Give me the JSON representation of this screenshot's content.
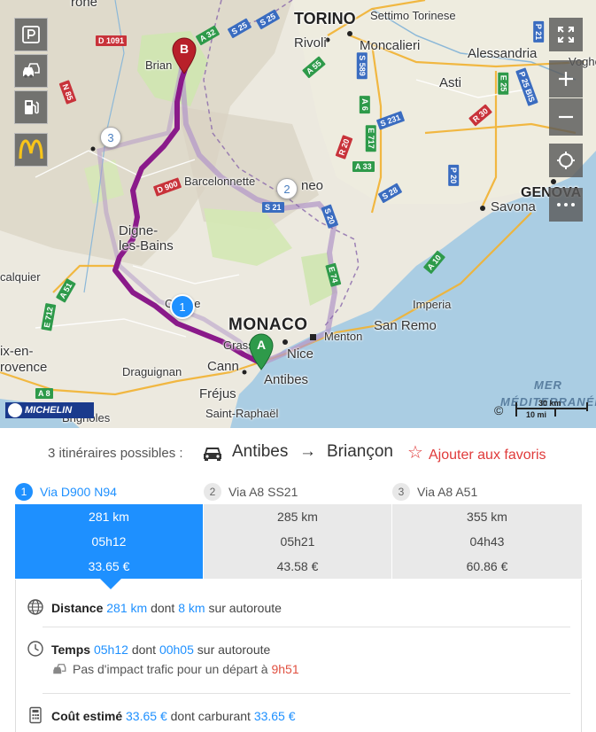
{
  "map": {
    "places": {
      "torino": "TORINO",
      "settimo": "Settimo Torinese",
      "rivoli": "Rivoli",
      "moncalieri": "Moncalieri",
      "alessandria": "Alessandria",
      "voghera": "Voghe",
      "asti": "Asti",
      "briancon": "Brian",
      "barcelonnette": "Barcelonnette",
      "cuneo": "neo",
      "genova": "GENOVA",
      "savona": "Savona",
      "digne1": "Digne-",
      "digne2": "les-Bains",
      "forcalquier": "calquier",
      "castellane": "C    llane",
      "monaco": "MONACO",
      "menton": "Menton",
      "imperia": "Imperia",
      "sanremo": "San Remo",
      "nice": "Nice",
      "grasse": "Grass",
      "cannes": "Cann",
      "antibes": "Antibes",
      "draguignan": "Draguignan",
      "frejus": "Fréjus",
      "saintraphael": "Saint-Raphaël",
      "brignoles": "Brignoles",
      "aix1": "ix-en-",
      "aix2": "rovence",
      "sea1": "MER",
      "sea2": "MÉDITERRANÉE",
      "top_brone": "rône"
    },
    "shields": {
      "d1091": "D 1091",
      "a32": "A 32",
      "s25": "S 25",
      "a55": "A 55",
      "s589": "S 589",
      "e717": "E 717",
      "a6": "A 6",
      "s231": "S 231",
      "r20": "R 20",
      "a33": "A 33",
      "e25": "E 25",
      "p25bis": "P 25 BIS",
      "r30": "R 30",
      "n85": "N 85",
      "d900": "D 900",
      "s21": "S 21",
      "s20": "S 20",
      "e74": "E 74",
      "s28": "S 28",
      "a10": "A 10",
      "p20": "P 20",
      "a51": "A 51",
      "a8": "A 8",
      "e712": "E 712",
      "p21": "P 21"
    },
    "route_markers": [
      "1",
      "2",
      "3"
    ],
    "pins": {
      "start": "A",
      "end": "B"
    },
    "logo": "MICHELIN",
    "copyright": "©",
    "scale": {
      "km": "30 km",
      "mi": "10 mi"
    },
    "controls_left": [
      "parking-icon",
      "traffic-icon",
      "fuel-icon",
      "mcdonalds-icon"
    ],
    "controls_right": [
      "fullscreen-icon",
      "zoom-in-icon",
      "zoom-out-icon",
      "locate-icon",
      "more-icon"
    ]
  },
  "header": {
    "possible": "3 itinéraires possibles :",
    "from": "Antibes",
    "arrow": "→",
    "to": "Briançon",
    "favorite": "Ajouter aux favoris"
  },
  "tabs": [
    {
      "num": "1",
      "label": "Via D900 N94"
    },
    {
      "num": "2",
      "label": "Via A8 SS21"
    },
    {
      "num": "3",
      "label": "Via A8 A51"
    }
  ],
  "table": {
    "rows": [
      [
        "281 km",
        "285 km",
        "355 km"
      ],
      [
        "05h12",
        "05h21",
        "04h43"
      ],
      [
        "33.65 €",
        "43.58 €",
        "60.86 €"
      ]
    ]
  },
  "details": {
    "distance": {
      "label": "Distance",
      "total": "281 km",
      "mid": "dont",
      "highway": "8 km",
      "suffix": "sur autoroute"
    },
    "time": {
      "label": "Temps",
      "total": "05h12",
      "mid": "dont",
      "highway": "00h05",
      "suffix": "sur autoroute",
      "traffic_prefix": "Pas d'impact trafic pour un départ à",
      "departure": "9h51"
    },
    "cost": {
      "label": "Coût estimé",
      "total": "33.65 €",
      "mid": "dont carburant",
      "fuel": "33.65 €"
    }
  },
  "colors": {
    "accent": "#1e90ff",
    "route_main": "#8a1a8a",
    "pin_start": "#2e9a4a",
    "pin_end": "#b8202a",
    "favorite": "#e03a3a"
  }
}
